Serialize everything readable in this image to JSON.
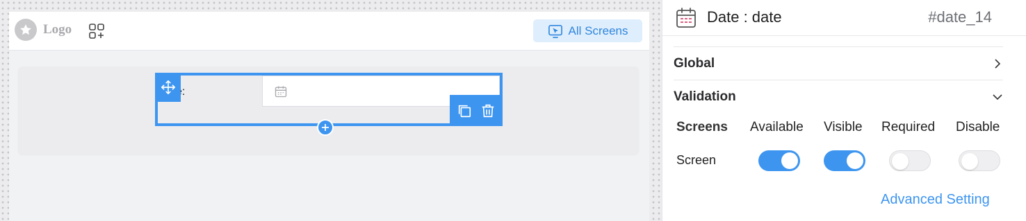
{
  "header": {
    "logo_text": "Logo",
    "all_screens_label": "All Screens"
  },
  "field": {
    "label_fragment": "e:",
    "date_value": ""
  },
  "panel": {
    "title": "Date : date",
    "field_id": "#date_14",
    "sections": {
      "global": "Global",
      "validation": "Validation"
    },
    "table": {
      "headers": [
        "Screens",
        "Available",
        "Visible",
        "Required",
        "Disable"
      ],
      "rows": [
        {
          "screen": "Screen",
          "available": true,
          "visible": true,
          "required": false,
          "disable": false
        }
      ]
    },
    "advanced_link": "Advanced Setting"
  },
  "colors": {
    "accent": "#3d95f0",
    "accent_light": "#dfeefc",
    "calendar_icon": "#d64b6f"
  }
}
